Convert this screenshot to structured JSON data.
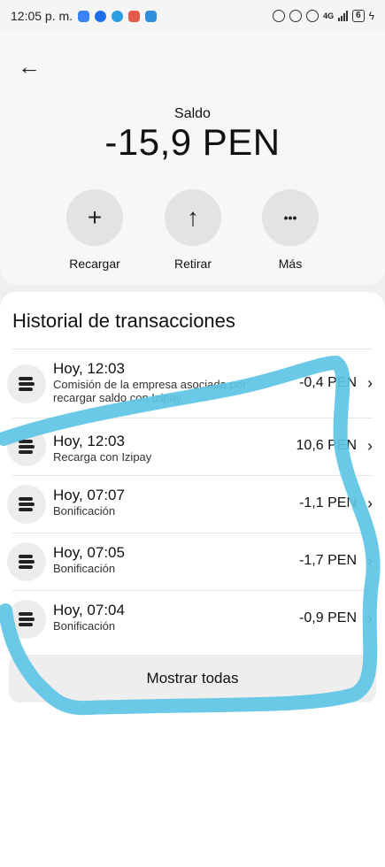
{
  "status_bar": {
    "time": "12:05 p. m.",
    "network": "4G",
    "battery": "6",
    "app_icons": [
      {
        "name": "app-icon-blue",
        "color": "#3b82f6"
      },
      {
        "name": "messenger-icon",
        "color": "#1e6fe8"
      },
      {
        "name": "telegram-icon",
        "color": "#2aa0e3"
      },
      {
        "name": "app-icon-red",
        "color": "#e25b4a"
      },
      {
        "name": "app-icon-teal",
        "color": "#2f8fdc"
      }
    ]
  },
  "header": {
    "back_icon": "arrow-left-icon",
    "balance_label": "Saldo",
    "balance_value": "-15,9 PEN"
  },
  "actions": [
    {
      "label": "Recargar",
      "icon": "plus-icon",
      "glyph": "+"
    },
    {
      "label": "Retirar",
      "icon": "arrow-up-icon",
      "glyph": "↑"
    },
    {
      "label": "Más",
      "icon": "more-icon",
      "glyph": "•••"
    }
  ],
  "history": {
    "title": "Historial de transacciones",
    "transactions": [
      {
        "title": "Hoy, 12:03",
        "subtitle": "Comisión de la empresa asociada por recargar saldo con Izipay",
        "amount": "-0,4 PEN",
        "chevron": true
      },
      {
        "title": "Hoy, 12:03",
        "subtitle": "Recarga con Izipay",
        "amount": "10,6 PEN",
        "chevron": true
      },
      {
        "title": "Hoy, 07:07",
        "subtitle": "Bonificación",
        "amount": "-1,1 PEN",
        "chevron": true
      },
      {
        "title": "Hoy, 07:05",
        "subtitle": "Bonificación",
        "amount": "-1,7 PEN",
        "chevron": true
      },
      {
        "title": "Hoy, 07:04",
        "subtitle": "Bonificación",
        "amount": "-0,9 PEN",
        "chevron": true
      }
    ],
    "show_all_label": "Mostrar todas"
  },
  "colors": {
    "scribble": "#5ec4e6"
  }
}
